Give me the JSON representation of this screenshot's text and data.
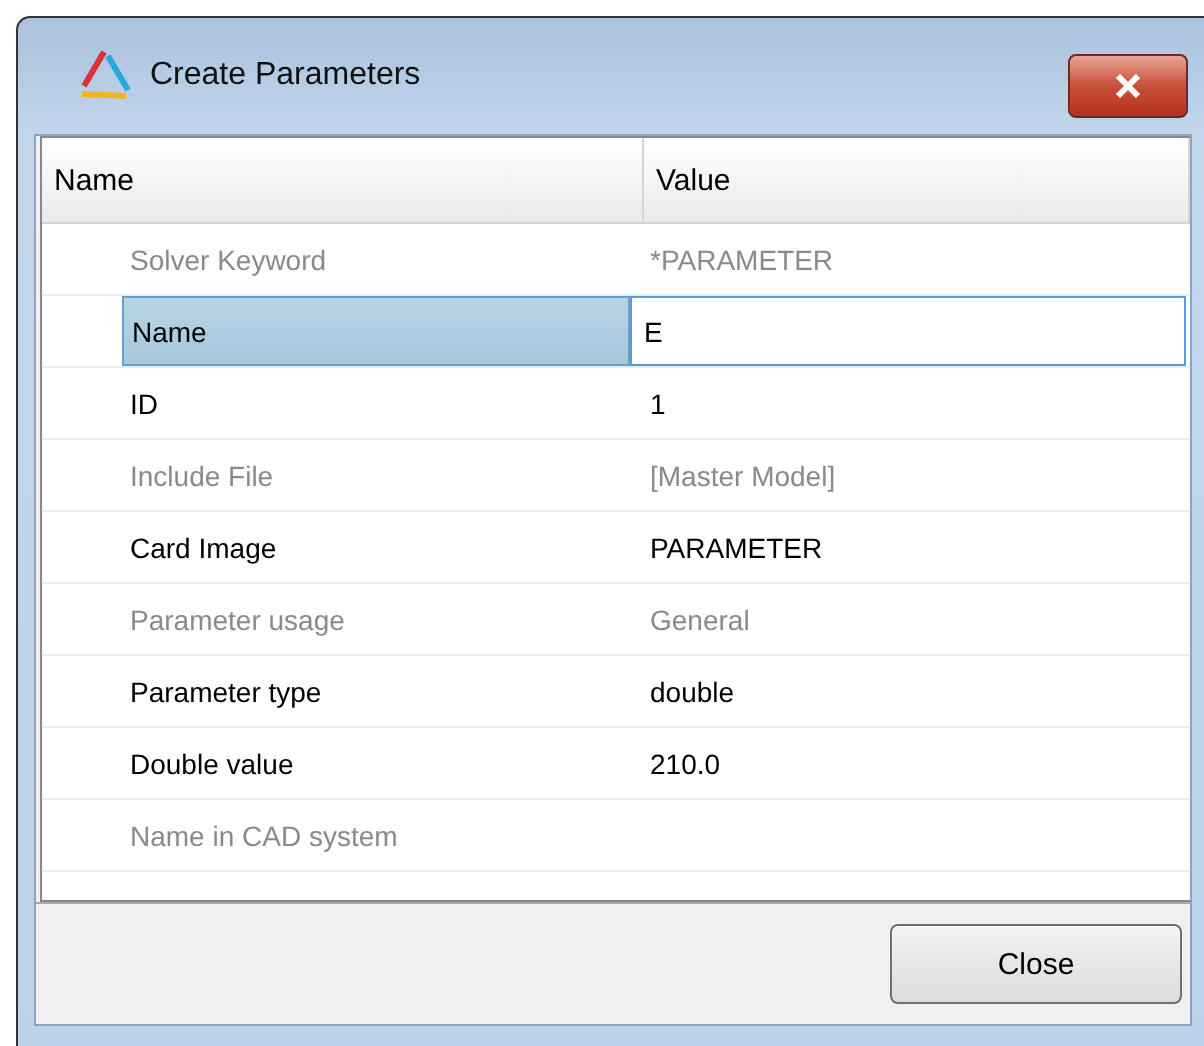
{
  "window": {
    "title": "Create Parameters"
  },
  "table": {
    "columns": [
      "Name",
      "Value"
    ],
    "rows": [
      {
        "name": "Solver Keyword",
        "value": "*PARAMETER",
        "disabled": true,
        "selected": false,
        "editing": false
      },
      {
        "name": "Name",
        "value": "E",
        "disabled": false,
        "selected": true,
        "editing": true
      },
      {
        "name": "ID",
        "value": "1",
        "disabled": false,
        "selected": false,
        "editing": false
      },
      {
        "name": "Include File",
        "value": "[Master Model]",
        "disabled": true,
        "selected": false,
        "editing": false
      },
      {
        "name": "Card Image",
        "value": "PARAMETER",
        "disabled": false,
        "selected": false,
        "editing": false
      },
      {
        "name": "Parameter usage",
        "value": "General",
        "disabled": true,
        "selected": false,
        "editing": false
      },
      {
        "name": "Parameter type",
        "value": "double",
        "disabled": false,
        "selected": false,
        "editing": false
      },
      {
        "name": "Double value",
        "value": "210.0",
        "disabled": false,
        "selected": false,
        "editing": false
      },
      {
        "name": "Name in CAD system",
        "disabled": true,
        "selected": false,
        "editing": false
      }
    ]
  },
  "buttons": [
    "Close"
  ]
}
